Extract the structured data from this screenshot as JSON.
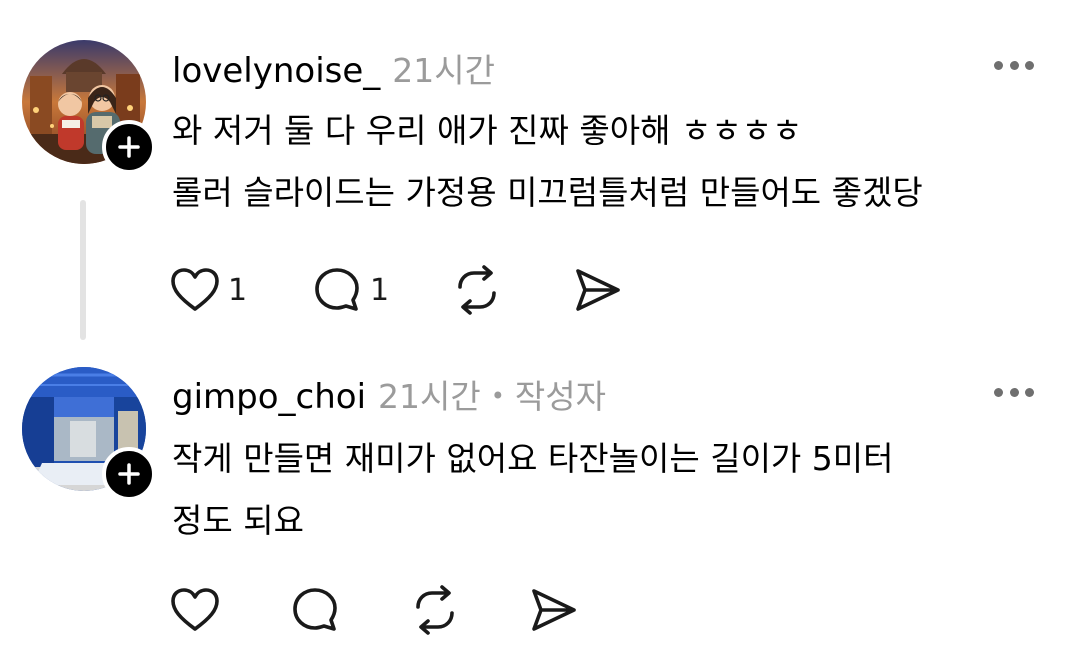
{
  "comments": [
    {
      "username": "lovelynoise_",
      "time": "21시간",
      "author_tag": "",
      "lines": [
        "와 저거 둘 다 우리 애가 진짜 좋아해 ㅎㅎㅎㅎ",
        "롤러 슬라이드는 가정용 미끄럼틀처럼 만들어도 좋겠당"
      ],
      "like_count": "1",
      "reply_count": "1",
      "avatar_icon": "avatar-couple-illustration"
    },
    {
      "username": "gimpo_choi",
      "time": "21시간",
      "separator": "•",
      "author_tag": "작성자",
      "lines": [
        "작게 만들면 재미가 없어요 타잔놀이는 길이가 5미터",
        "정도 되요"
      ],
      "like_count": "",
      "reply_count": "",
      "avatar_icon": "avatar-blue-corridor-photo"
    }
  ],
  "icons": {
    "like": "heart-icon",
    "reply": "comment-bubble-icon",
    "repost": "repost-icon",
    "share": "send-icon",
    "more": "more-dots-icon",
    "follow": "plus-icon"
  }
}
